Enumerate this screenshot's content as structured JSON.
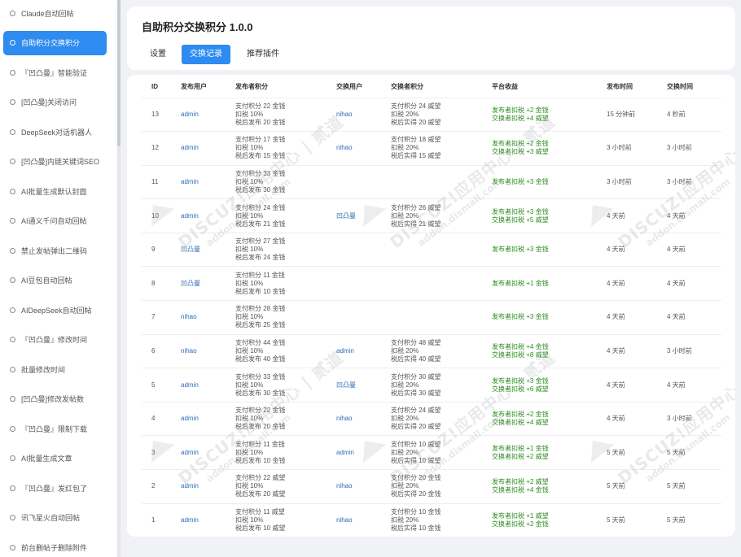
{
  "sidebar": {
    "items": [
      {
        "label": "Claude自动回帖"
      },
      {
        "label": "自助积分交换积分"
      },
      {
        "label": "『凹凸曼』智能验证"
      },
      {
        "label": "[凹凸曼]关闭访问"
      },
      {
        "label": "DeepSeek对话机器人"
      },
      {
        "label": "[凹凸曼]内链关键词SEO"
      },
      {
        "label": "AI批量生成默认封面"
      },
      {
        "label": "AI通义千问自动回帖"
      },
      {
        "label": "禁止发帖弹出二维码"
      },
      {
        "label": "AI豆包自动回帖"
      },
      {
        "label": "AIDeepSeek自动回帖"
      },
      {
        "label": "『凹凸曼』修改时间"
      },
      {
        "label": "批量修改时间"
      },
      {
        "label": "[凹凸曼]修改发帖数"
      },
      {
        "label": "『凹凸曼』限制下载"
      },
      {
        "label": "AI批量生成文章"
      },
      {
        "label": "『凹凸曼』发红包了"
      },
      {
        "label": "讯飞星火自动回帖"
      },
      {
        "label": "前台删帖子删除附件"
      }
    ],
    "active_index": 1
  },
  "header": {
    "title": "自助积分交换积分 1.0.0",
    "tabs": [
      {
        "label": "设置"
      },
      {
        "label": "交换记录"
      },
      {
        "label": "推荐插件"
      }
    ],
    "active_tab": 1
  },
  "table": {
    "columns": [
      "ID",
      "发布用户",
      "发布者积分",
      "交换用户",
      "交换者积分",
      "平台收益",
      "发布时间",
      "交换时间"
    ],
    "rows": [
      {
        "id": "13",
        "user": "admin",
        "pub": [
          "支付积分 22 金钱",
          "扣税 10%",
          "税后发布 20 金钱"
        ],
        "ex_user": "nihao",
        "ex": [
          "支付积分 24 威望",
          "扣税 20%",
          "税后实得 20 威望"
        ],
        "income": [
          "发布者扣税 +2 金钱",
          "交换者扣税 +4 威望"
        ],
        "pub_time": "15 分钟前",
        "ex_time": "4 秒前"
      },
      {
        "id": "12",
        "user": "admin",
        "pub": [
          "支付积分 17 金钱",
          "扣税 10%",
          "税后发布 15 金钱"
        ],
        "ex_user": "nihao",
        "ex": [
          "支付积分 18 威望",
          "扣税 20%",
          "税后实得 15 威望"
        ],
        "income": [
          "发布者扣税 +2 金钱",
          "交换者扣税 +3 威望"
        ],
        "pub_time": "3 小时前",
        "ex_time": "3 小时前"
      },
      {
        "id": "11",
        "user": "admin",
        "pub": [
          "支付积分 33 金钱",
          "扣税 10%",
          "税后发布 30 金钱"
        ],
        "ex_user": "",
        "ex": [],
        "income": [
          "发布者扣税 +3 金钱"
        ],
        "pub_time": "3 小时前",
        "ex_time": "3 小时前"
      },
      {
        "id": "10",
        "user": "admin",
        "pub": [
          "支付积分 24 金钱",
          "扣税 10%",
          "税后发布 21 金钱"
        ],
        "ex_user": "凹凸曼",
        "ex": [
          "支付积分 26 威望",
          "扣税 20%",
          "税后实得 21 威望"
        ],
        "income": [
          "发布者扣税 +3 金钱",
          "交换者扣税 +5 威望"
        ],
        "pub_time": "4 天前",
        "ex_time": "4 天前"
      },
      {
        "id": "9",
        "user": "凹凸曼",
        "pub": [
          "支付积分 27 金钱",
          "扣税 10%",
          "税后发布 24 金钱"
        ],
        "ex_user": "",
        "ex": [],
        "income": [
          "发布者扣税 +3 金钱"
        ],
        "pub_time": "4 天前",
        "ex_time": "4 天前"
      },
      {
        "id": "8",
        "user": "凹凸曼",
        "pub": [
          "支付积分 11 金钱",
          "扣税 10%",
          "税后发布 10 金钱"
        ],
        "ex_user": "",
        "ex": [],
        "income": [
          "发布者扣税 +1 金钱"
        ],
        "pub_time": "4 天前",
        "ex_time": "4 天前"
      },
      {
        "id": "7",
        "user": "nihao",
        "pub": [
          "支付积分 28 金钱",
          "扣税 10%",
          "税后发布 25 金钱"
        ],
        "ex_user": "",
        "ex": [],
        "income": [
          "发布者扣税 +3 金钱"
        ],
        "pub_time": "4 天前",
        "ex_time": "4 天前"
      },
      {
        "id": "6",
        "user": "nihao",
        "pub": [
          "支付积分 44 金钱",
          "扣税 10%",
          "税后发布 40 金钱"
        ],
        "ex_user": "admin",
        "ex": [
          "支付积分 48 威望",
          "扣税 20%",
          "税后实得 40 威望"
        ],
        "income": [
          "发布者扣税 +4 金钱",
          "交换者扣税 +8 威望"
        ],
        "pub_time": "4 天前",
        "ex_time": "3 小时前"
      },
      {
        "id": "5",
        "user": "admin",
        "pub": [
          "支付积分 33 金钱",
          "扣税 10%",
          "税后发布 30 金钱"
        ],
        "ex_user": "凹凸曼",
        "ex": [
          "支付积分 30 威望",
          "扣税 20%",
          "税后实得 30 威望"
        ],
        "income": [
          "发布者扣税 +3 金钱",
          "交换者扣税 +6 威望"
        ],
        "pub_time": "4 天前",
        "ex_time": "4 天前"
      },
      {
        "id": "4",
        "user": "admin",
        "pub": [
          "支付积分 22 金钱",
          "扣税 10%",
          "税后发布 20 金钱"
        ],
        "ex_user": "nihao",
        "ex": [
          "支付积分 24 威望",
          "扣税 20%",
          "税后实得 20 威望"
        ],
        "income": [
          "发布者扣税 +2 金钱",
          "交换者扣税 +4 威望"
        ],
        "pub_time": "4 天前",
        "ex_time": "3 小时前"
      },
      {
        "id": "3",
        "user": "admin",
        "pub": [
          "支付积分 11 金钱",
          "扣税 10%",
          "税后发布 10 金钱"
        ],
        "ex_user": "admin",
        "ex": [
          "支付积分 10 威望",
          "扣税 20%",
          "税后实得 10 威望"
        ],
        "income": [
          "发布者扣税 +1 金钱",
          "交换者扣税 +2 威望"
        ],
        "pub_time": "5 天前",
        "ex_time": "5 天前"
      },
      {
        "id": "2",
        "user": "admin",
        "pub": [
          "支付积分 22 威望",
          "扣税 10%",
          "税后发布 20 威望"
        ],
        "ex_user": "nihao",
        "ex": [
          "支付积分 20 金钱",
          "扣税 20%",
          "税后实得 20 金钱"
        ],
        "income": [
          "发布者扣税 +2 威望",
          "交换者扣税 +4 金钱"
        ],
        "pub_time": "5 天前",
        "ex_time": "5 天前"
      },
      {
        "id": "1",
        "user": "admin",
        "pub": [
          "支付积分 11 威望",
          "扣税 10%",
          "税后发布 10 威望"
        ],
        "ex_user": "nihao",
        "ex": [
          "支付积分 10 金钱",
          "扣税 20%",
          "税后实得 10 金钱"
        ],
        "income": [
          "发布者扣税 +1 威望",
          "交换者扣税 +2 金钱"
        ],
        "pub_time": "5 天前",
        "ex_time": "5 天前"
      }
    ]
  },
  "watermark": {
    "line1": "DISCUZ!应用中心 | 贰道",
    "line2": "addon.dismall.com"
  },
  "colors": {
    "accent": "#2e8bf0",
    "link": "#2d6bb5",
    "income_green": "#2b8a1e"
  }
}
